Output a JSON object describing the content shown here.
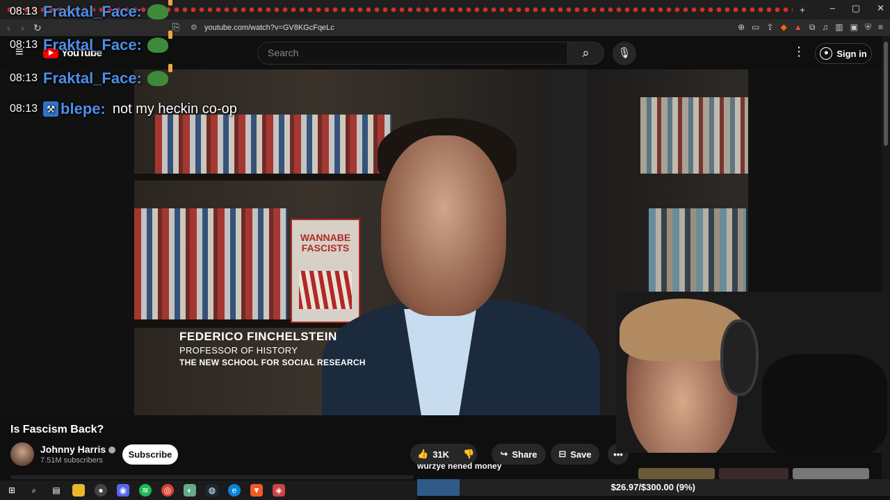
{
  "browser": {
    "url": "youtube.com/watch?v=GV8KGcFqeLc",
    "new_tab": "+",
    "window_controls": [
      "–",
      "▢",
      "✕"
    ]
  },
  "yt_header": {
    "logo_text": "YouTube",
    "search_placeholder": "Search",
    "signin_label": "Sign in"
  },
  "chat": [
    {
      "time": "08:13",
      "user": "Fraktal_Face:",
      "message": "",
      "emote": "pepe-icon",
      "badge": ""
    },
    {
      "time": "08:13",
      "user": "Fraktal_Face:",
      "message": "",
      "emote": "pepe-icon",
      "badge": ""
    },
    {
      "time": "08:13",
      "user": "Fraktal_Face:",
      "message": "",
      "emote": "pepe-icon",
      "badge": ""
    },
    {
      "time": "08:13",
      "user": "blepe:",
      "message": "not my heckin co-op",
      "emote": "",
      "badge": "pickaxe-badge-icon"
    }
  ],
  "video": {
    "lower_third_name": "FEDERICO FINCHELSTEIN",
    "lower_third_title": "PROFESSOR OF HISTORY",
    "lower_third_org": "THE NEW SCHOOL FOR SOCIAL RESEARCH",
    "book_title": "WANNABE FASCISTS"
  },
  "meta": {
    "title": "Is Fascism Back?",
    "channel": "Johnny Harris",
    "subscribers": "7.51M subscribers",
    "subscribe_label": "Subscribe",
    "likes": "31K",
    "share_label": "Share",
    "save_label": "Save"
  },
  "stream_overlay": {
    "goal_text": "wurzye nened money",
    "donation_text": "$26.97/$300.00 (9%)",
    "donation_fraction": 0.09
  },
  "colors": {
    "chat_user": "#4c8fe8",
    "yt_red": "#ff0000",
    "donation_fill": "#2f5a8a"
  }
}
